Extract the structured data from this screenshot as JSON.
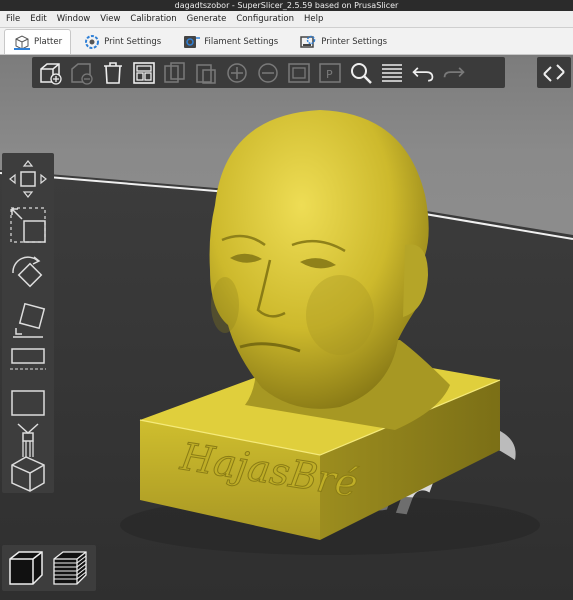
{
  "window": {
    "title": "dagadtszobor - SuperSlicer_2.5.59  based on PrusaSlicer"
  },
  "menu": [
    "File",
    "Edit",
    "Window",
    "View",
    "Calibration",
    "Generate",
    "Configuration",
    "Help"
  ],
  "tabs": [
    {
      "label": "Platter",
      "icon": "cube-icon",
      "active": true
    },
    {
      "label": "Print Settings",
      "icon": "gear-icon",
      "active": false
    },
    {
      "label": "Filament Settings",
      "icon": "spool-icon",
      "active": false
    },
    {
      "label": "Printer Settings",
      "icon": "printer-icon",
      "active": false
    }
  ],
  "top_toolbar": {
    "buttons": [
      "add",
      "delete",
      "delete-all",
      "arrange",
      "copy",
      "paste",
      "add-instance",
      "remove-instance",
      "split-objects",
      "split-parts",
      "layers-editing",
      "search",
      "variable-layer-height",
      "undo",
      "redo"
    ],
    "disabled": [
      "delete",
      "copy",
      "paste",
      "add-instance",
      "remove-instance",
      "split-objects",
      "split-parts",
      "redo"
    ]
  },
  "left_toolbar": {
    "buttons": [
      "move",
      "scale",
      "rotate",
      "place-on-face",
      "cut",
      "hollow",
      "support-points",
      "fdm-supports",
      "seam-painting",
      "mmu-segmentation"
    ]
  },
  "view_toggle": {
    "buttons": [
      "3d-view",
      "preview-layers"
    ]
  },
  "colors": {
    "model": "#d4c12c",
    "bed": "#3a3a3a",
    "toolbar": "#3b3b3b",
    "accent": "#2e7fd6"
  },
  "model": {
    "embossed_text": "HajasBré",
    "bed_logo_text": "er"
  }
}
